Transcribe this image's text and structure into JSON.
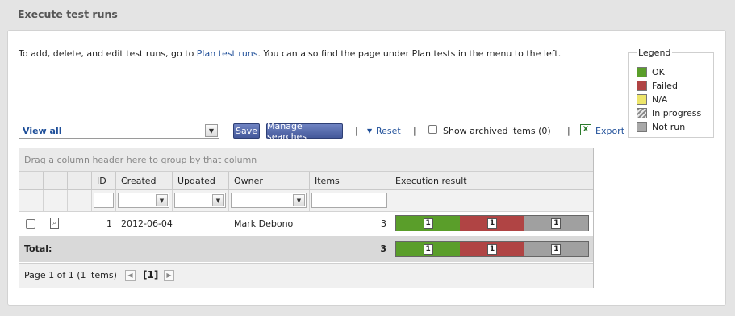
{
  "page": {
    "title": "Execute test runs"
  },
  "info": {
    "prefix": "To add, delete, and edit test runs, go to ",
    "link": "Plan test runs",
    "suffix": ". You can also find the page under Plan tests in the menu to the left."
  },
  "legend": {
    "title": "Legend",
    "items": [
      {
        "label": "OK",
        "color": "#5a9e2a"
      },
      {
        "label": "Failed",
        "color": "#b04444"
      },
      {
        "label": "N/A",
        "color": "#ede56a"
      },
      {
        "label": "In progress",
        "color": "hatched-gray"
      },
      {
        "label": "Not run",
        "color": "#a8a8a8"
      }
    ]
  },
  "toolbar": {
    "view_selected": "View all",
    "save_label": "Save",
    "manage_label": "Manage searches",
    "sep": "|",
    "reset_label": "Reset",
    "archived_label": "Show archived items (0)",
    "export_label": "Export"
  },
  "grid": {
    "group_hint": "Drag a column header here to group by that column",
    "columns": [
      "ID",
      "Created",
      "Updated",
      "Owner",
      "Items",
      "Execution result"
    ],
    "rows": [
      {
        "id": "1",
        "created": "2012-06-04",
        "updated": "",
        "owner": "Mark Debono",
        "items": "3",
        "result": {
          "ok": "1",
          "failed": "1",
          "not_run": "1"
        }
      }
    ],
    "total": {
      "label": "Total:",
      "items": "3",
      "result": {
        "ok": "1",
        "failed": "1",
        "not_run": "1"
      }
    },
    "pager": {
      "text": "Page 1 of 1 (1 items)",
      "current": "[1]"
    }
  },
  "colors": {
    "ok": "#5a9e2a",
    "failed": "#b04444",
    "not_run": "#a0a0a0",
    "link": "#1f4f99"
  }
}
